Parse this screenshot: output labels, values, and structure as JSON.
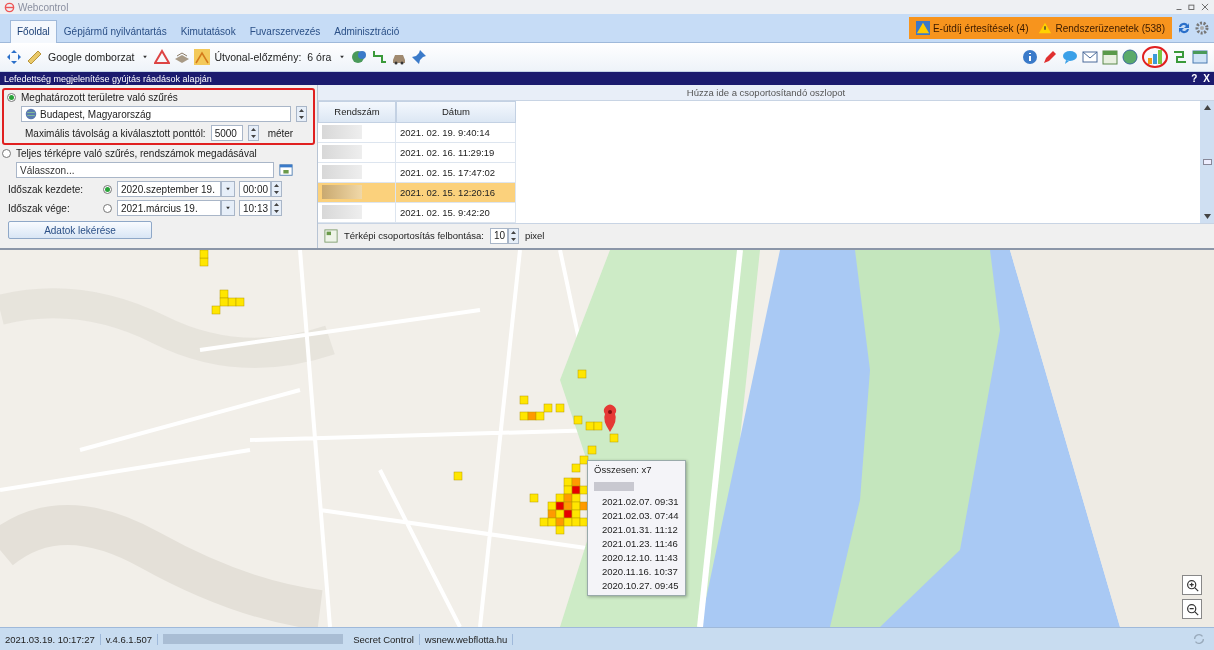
{
  "window": {
    "title": "Webcontrol"
  },
  "tabs": [
    {
      "label": "Főoldal",
      "selected": true
    },
    {
      "label": "Gépjármű nyilvántartás",
      "selected": false
    },
    {
      "label": "Kimutatások",
      "selected": false
    },
    {
      "label": "Fuvarszervezés",
      "selected": false
    },
    {
      "label": "Adminisztráció",
      "selected": false
    }
  ],
  "alerts": [
    {
      "label": "E-útdíj értesítések (4)"
    },
    {
      "label": "Rendszerüzenetek (538)"
    }
  ],
  "toolbar": {
    "map_type": "Google domborzat",
    "route_history_label": "Útvonal-előzmény:",
    "route_history_value": "6 óra"
  },
  "panel": {
    "title": "Lefedettség megjelenítése gyújtás ráadások alapján",
    "help": "?",
    "close": "X"
  },
  "filter": {
    "modes": [
      {
        "label": "Meghatározott területre való szűrés",
        "selected": true
      },
      {
        "label": "Teljes térképre való szűrés, rendszámok megadásával",
        "selected": false
      }
    ],
    "location": "Budapest, Magyarország",
    "distance_label": "Maximális távolság a kiválasztott ponttól:",
    "distance": "5000",
    "distance_unit": "méter",
    "plates_placeholder": "Válasszon...",
    "periods": [
      {
        "label": "Időszak kezdete:",
        "selected": true,
        "date": "2020.szeptember 19.",
        "time": "00:00"
      },
      {
        "label": "Időszak vége:",
        "selected": false,
        "date": "2021.március 19.",
        "time": "10:13"
      }
    ],
    "submit": "Adatok lekérése"
  },
  "grid": {
    "group_hint": "Húzza ide a csoportosítandó oszlopot",
    "columns": [
      "Rendszám",
      "Dátum"
    ],
    "rows": [
      {
        "date": "2021. 02. 19. 9:40:14",
        "selected": false
      },
      {
        "date": "2021. 02. 16. 11:29:19",
        "selected": false
      },
      {
        "date": "2021. 02. 15. 17:47:02",
        "selected": false
      },
      {
        "date": "2021. 02. 15. 12:20:16",
        "selected": true
      },
      {
        "date": "2021. 02. 15. 9:42:20",
        "selected": false
      }
    ],
    "resolution_label": "Térképi csoportosítás felbontása:",
    "resolution": "10",
    "resolution_unit": "pixel"
  },
  "map": {
    "popup": {
      "title": "Összesen: x7",
      "times": [
        "2021.02.07. 09:31",
        "2021.02.03. 07:44",
        "2021.01.31. 11:12",
        "2021.01.23. 11:46",
        "2020.12.10. 11:43",
        "2020.11.16. 10:37",
        "2020.10.27. 09:45"
      ]
    }
  },
  "status_bar": {
    "timestamp": "2021.03.19. 10:17:27",
    "version": "v.4.6.1.507",
    "company": "Secret Control",
    "server": "wsnew.webflotta.hu"
  }
}
